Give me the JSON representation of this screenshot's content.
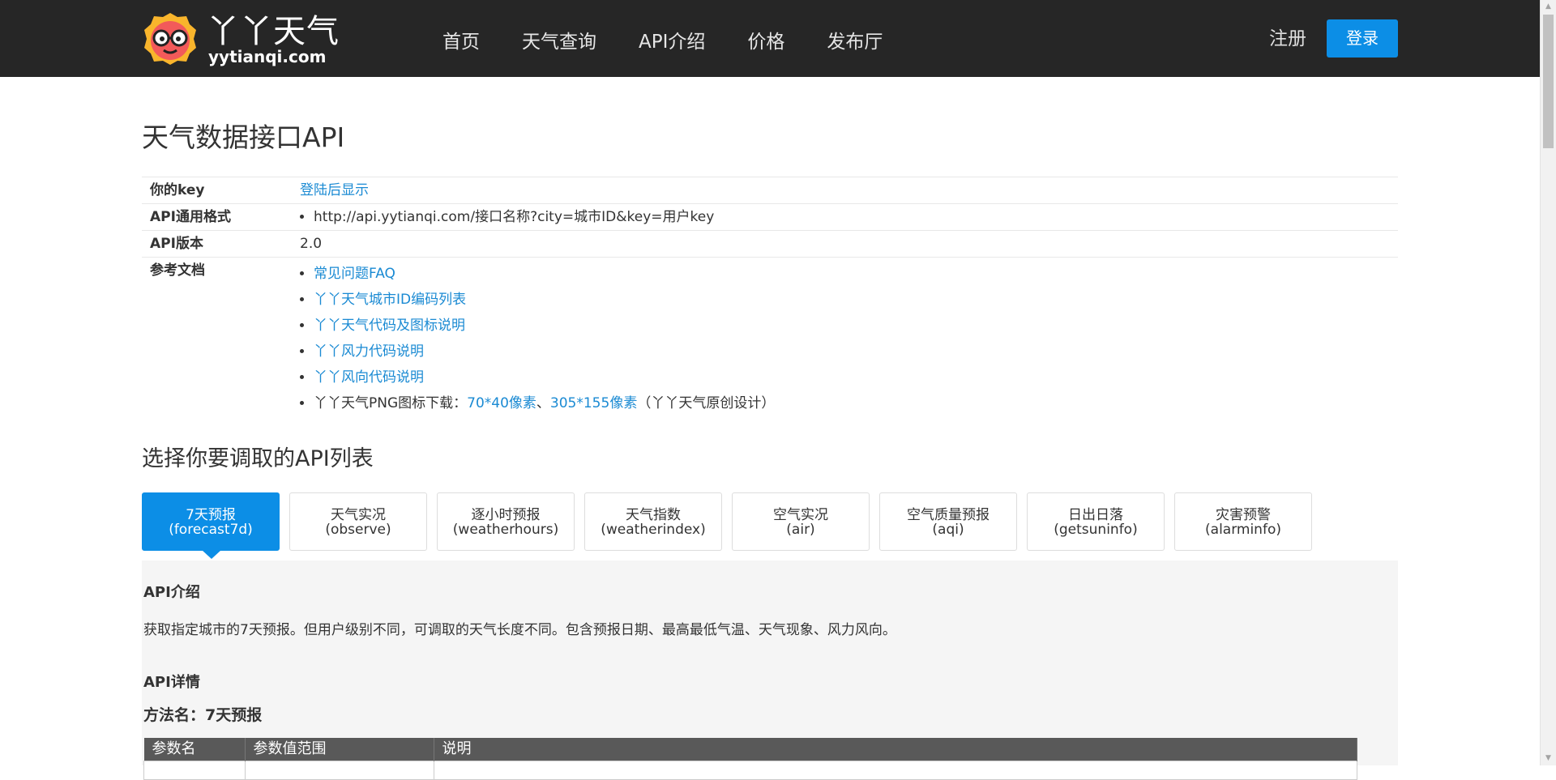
{
  "header": {
    "logo_cn": "丫丫天气",
    "logo_en": "yytianqi.com",
    "nav": [
      "首页",
      "天气查询",
      "API介绍",
      "价格",
      "发布厅"
    ],
    "register": "注册",
    "login": "登录"
  },
  "page": {
    "title": "天气数据接口API"
  },
  "info": {
    "key_label": "你的key",
    "key_value": "登陆后显示",
    "format_label": "API通用格式",
    "format_value": "http://api.yytianqi.com/接口名称?city=城市ID&key=用户key",
    "version_label": "API版本",
    "version_value": "2.0",
    "docs_label": "参考文档",
    "docs": [
      "常见问题FAQ",
      "丫丫天气城市ID编码列表",
      "丫丫天气代码及图标说明",
      "丫丫风力代码说明",
      "丫丫风向代码说明"
    ],
    "png_prefix": "丫丫天气PNG图标下载：",
    "png_link1": "70*40像素",
    "png_sep": "、",
    "png_link2": "305*155像素",
    "png_suffix": "（丫丫天气原创设计）"
  },
  "api_list": {
    "title": "选择你要调取的API列表",
    "tabs": [
      {
        "cn": "7天预报",
        "en": "(forecast7d)"
      },
      {
        "cn": "天气实况",
        "en": "(observe)"
      },
      {
        "cn": "逐小时预报",
        "en": "(weatherhours)"
      },
      {
        "cn": "天气指数",
        "en": "(weatherindex)"
      },
      {
        "cn": "空气实况",
        "en": "(air)"
      },
      {
        "cn": "空气质量预报",
        "en": "(aqi)"
      },
      {
        "cn": "日出日落",
        "en": "(getsuninfo)"
      },
      {
        "cn": "灾害预警",
        "en": "(alarminfo)"
      }
    ],
    "active_index": 0
  },
  "panel": {
    "intro_title": "API介绍",
    "intro_text": "获取指定城市的7天预报。但用户级别不同，可调取的天气长度不同。包含预报日期、最高最低气温、天气现象、风力风向。",
    "detail_title": "API详情",
    "method": "方法名：7天预报",
    "columns": [
      "参数名",
      "参数值范围",
      "说明"
    ]
  },
  "colors": {
    "header_bg": "#262626",
    "accent": "#0c8ee6",
    "link": "#1a8ad3"
  }
}
